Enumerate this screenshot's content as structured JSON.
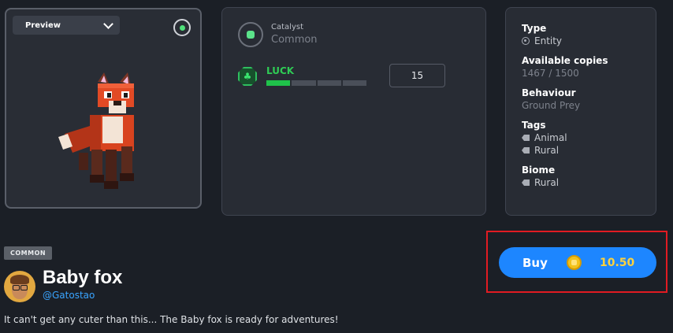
{
  "preview": {
    "select_label": "Preview",
    "subject": "red voxel fox"
  },
  "catalyst": {
    "title": "Catalyst",
    "rarity": "Common",
    "stat": {
      "label": "LUCK",
      "value": "15",
      "bar_fraction": 0.25
    }
  },
  "info": {
    "type_key": "Type",
    "type_val": "Entity",
    "copies_key": "Available copies",
    "copies_val": "1467 / 1500",
    "behaviour_key": "Behaviour",
    "behaviour_val": "Ground Prey",
    "tags_key": "Tags",
    "tags": [
      "Animal",
      "Rural"
    ],
    "biome_key": "Biome",
    "biome_val": "Rural"
  },
  "item": {
    "rarity_badge": "COMMON",
    "name": "Baby fox",
    "creator": "@Gatostao",
    "description": "It can't get any cuter than this... The Baby fox is ready for adventures!"
  },
  "buy": {
    "label": "Buy",
    "price": "10.50",
    "currency_icon": "coin-icon"
  },
  "colors": {
    "accent": "#1d86ff",
    "luck_green": "#1fc24a",
    "price_gold": "#ffd23d",
    "highlight_red": "#e11b22"
  }
}
